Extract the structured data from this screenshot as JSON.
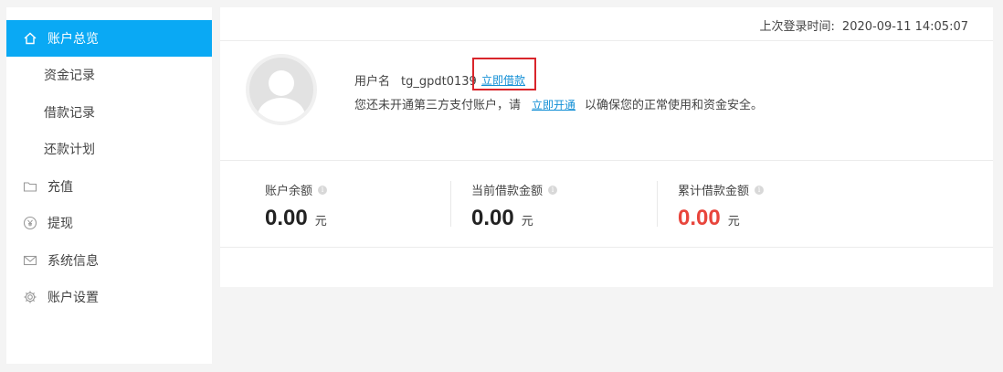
{
  "sidebar": {
    "items": [
      {
        "label": "账户总览",
        "icon": "home-icon",
        "active": true,
        "sub": false
      },
      {
        "label": "资金记录",
        "icon": "",
        "active": false,
        "sub": true
      },
      {
        "label": "借款记录",
        "icon": "",
        "active": false,
        "sub": true
      },
      {
        "label": "还款计划",
        "icon": "",
        "active": false,
        "sub": true
      },
      {
        "label": "充值",
        "icon": "folder-icon",
        "active": false,
        "sub": false
      },
      {
        "label": "提现",
        "icon": "yen-coin-icon",
        "active": false,
        "sub": false
      },
      {
        "label": "系统信息",
        "icon": "mail-icon",
        "active": false,
        "sub": false
      },
      {
        "label": "账户设置",
        "icon": "gear-icon",
        "active": false,
        "sub": false
      }
    ],
    "active_color": "#0aa9f4"
  },
  "header": {
    "last_login_label": "上次登录时间:",
    "last_login_value": "2020-09-11 14:05:07"
  },
  "user": {
    "username_label": "用户名",
    "username": "tg_gpdt0139",
    "borrow_link": "立即借款",
    "notice_prefix": "您还未开通第三方支付账户，请",
    "open_link": "立即开通",
    "notice_suffix": "以确保您的正常使用和资金安全。"
  },
  "stats": [
    {
      "label": "账户余额",
      "value": "0.00",
      "unit": "元",
      "highlight": false
    },
    {
      "label": "当前借款金额",
      "value": "0.00",
      "unit": "元",
      "highlight": false
    },
    {
      "label": "累计借款金额",
      "value": "0.00",
      "unit": "元",
      "highlight": true
    }
  ],
  "colors": {
    "accent": "#0aa9f4",
    "link": "#1490d6",
    "highlight_red": "#e8453c",
    "box_red": "#d9252b"
  }
}
